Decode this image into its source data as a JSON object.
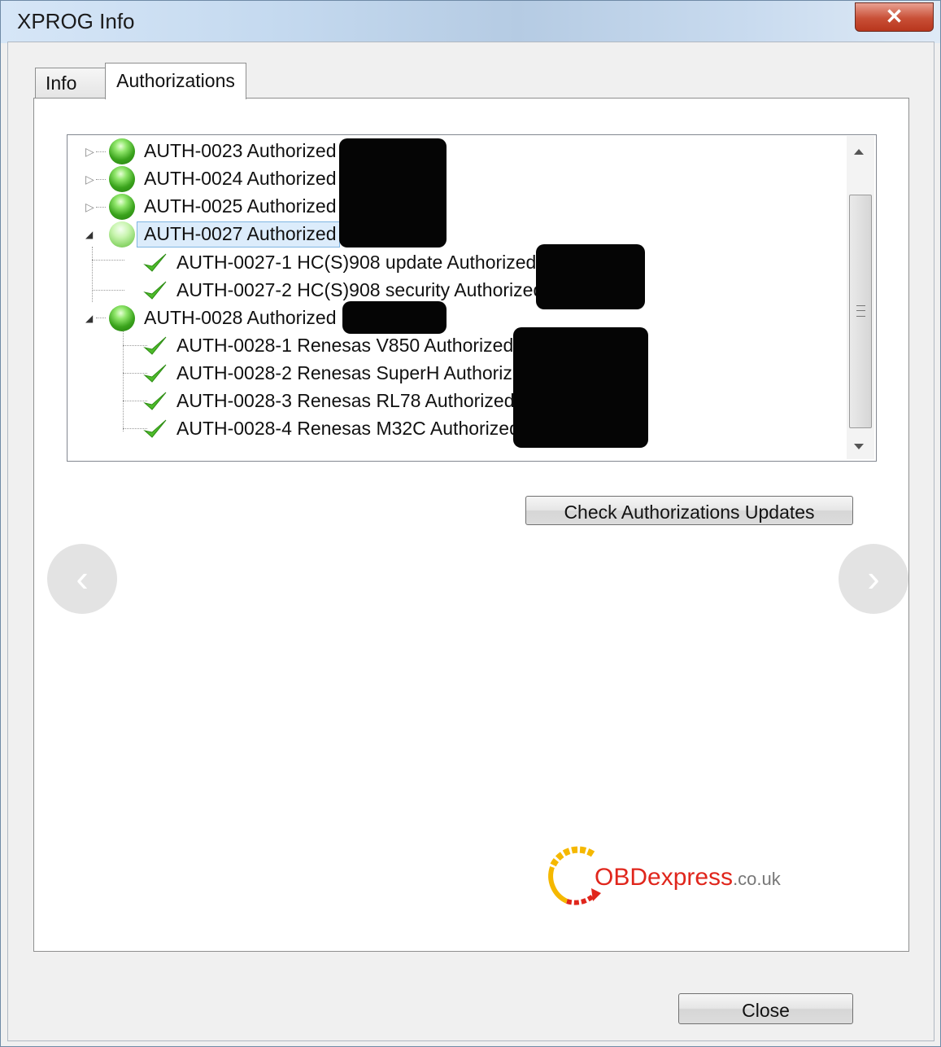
{
  "window": {
    "title": "XPROG Info",
    "close_glyph": "✕"
  },
  "tabs": [
    {
      "label": "Info",
      "active": false
    },
    {
      "label": "Authorizations",
      "active": true
    }
  ],
  "tree": {
    "items": [
      {
        "label": "AUTH-0023 Authorized",
        "expander": "▷",
        "icon": "green-ball-icon"
      },
      {
        "label": "AUTH-0024 Authorized",
        "expander": "▷",
        "icon": "green-ball-icon"
      },
      {
        "label": "AUTH-0025 Authorized",
        "expander": "▷",
        "icon": "green-ball-icon"
      },
      {
        "label": "AUTH-0027 Authorized",
        "expander": "◢",
        "icon": "green-ball-icon",
        "selected": true,
        "children": [
          {
            "label": "AUTH-0027-1 HC(S)908 update Authorized",
            "icon": "checkmark-icon"
          },
          {
            "label": "AUTH-0027-2 HC(S)908 security Authorized",
            "icon": "checkmark-icon"
          }
        ]
      },
      {
        "label": "AUTH-0028 Authorized",
        "expander": "◢",
        "icon": "green-ball-icon",
        "children": [
          {
            "label": "AUTH-0028-1 Renesas V850 Authorized",
            "icon": "checkmark-icon"
          },
          {
            "label": "AUTH-0028-2 Renesas SuperH Authoriz",
            "icon": "checkmark-icon"
          },
          {
            "label": "AUTH-0028-3 Renesas RL78 Authorized",
            "icon": "checkmark-icon"
          },
          {
            "label": "AUTH-0028-4 Renesas M32C Authorized",
            "icon": "checkmark-icon"
          }
        ]
      }
    ]
  },
  "buttons": {
    "check_updates": "Check Authorizations Updates",
    "close": "Close"
  },
  "nav": {
    "prev": "‹",
    "next": "›"
  },
  "watermark": {
    "brand": "OBDexpress",
    "tld": ".co.uk"
  },
  "colors": {
    "accent_green": "#3aa31c",
    "logo_red": "#e0261c",
    "logo_yellow": "#f5b800"
  }
}
